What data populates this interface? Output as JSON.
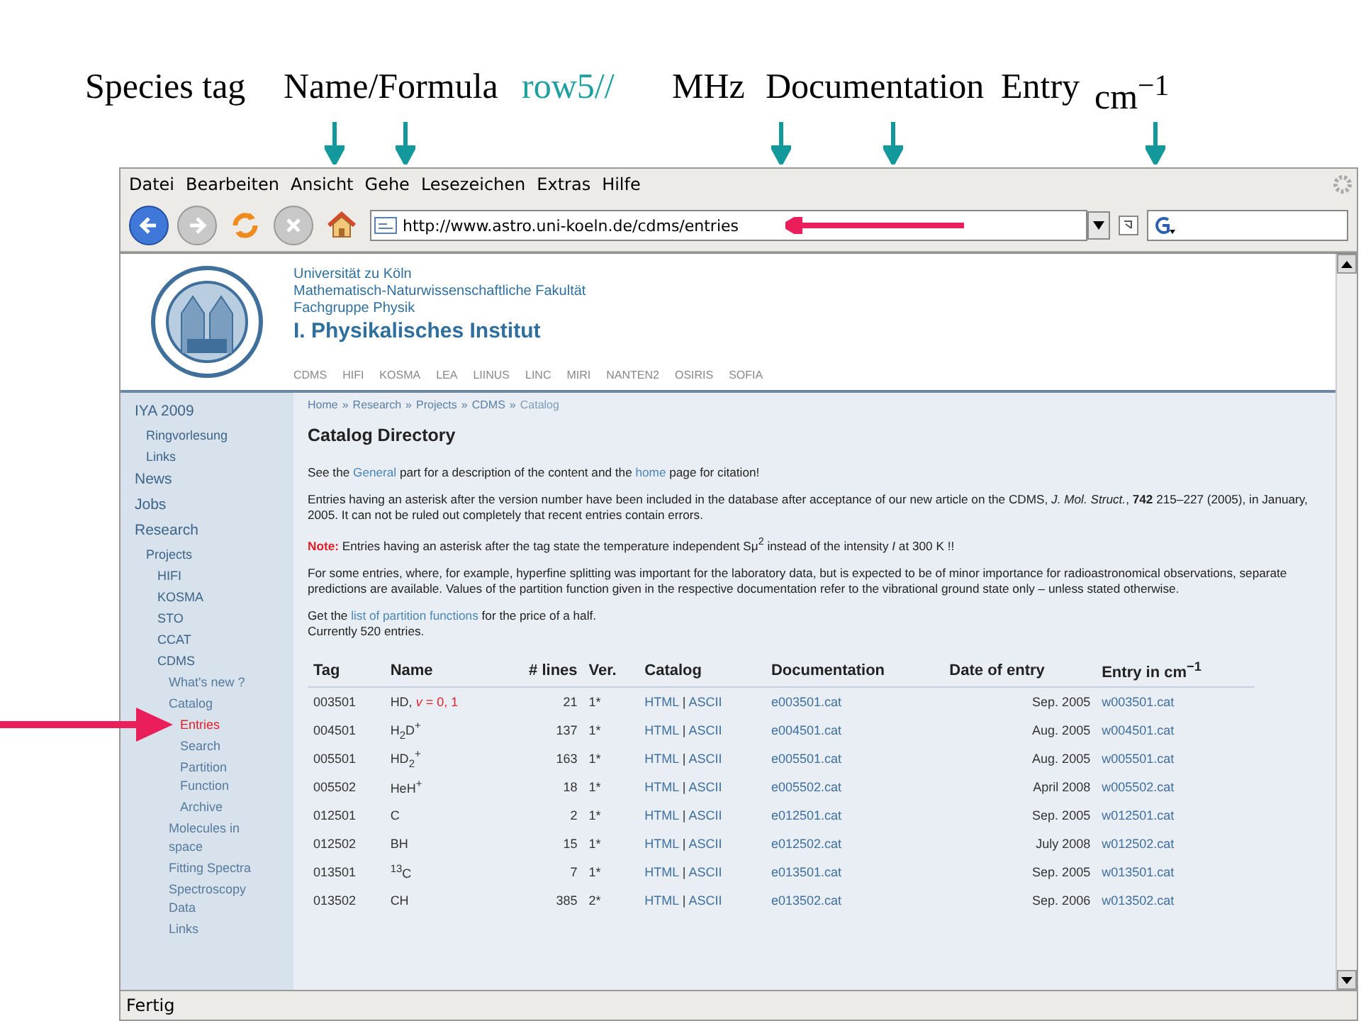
{
  "annotations": [
    {
      "text": "Species tag",
      "kind": "plain"
    },
    {
      "text": "Name/Formula",
      "kind": "plain"
    },
    {
      "text": "row5//",
      "kind": "accent"
    },
    {
      "text": "MHz",
      "kind": "plain"
    },
    {
      "text": "Documentation",
      "kind": "plain"
    },
    {
      "text": "Entry",
      "kind": "plain"
    },
    {
      "text": "cm$^{−1}$",
      "kind": "plain"
    }
  ],
  "menu": [
    "Datei",
    "Bearbeiten",
    "Ansicht",
    "Gehe",
    "Lesezeichen",
    "Extras",
    "Hilfe"
  ],
  "address": {
    "value": "http://www.astro.uni-koeln.de/cdms/entries"
  },
  "header": {
    "lines": [
      "Universität zu Köln",
      "Mathematisch-Naturwissenschaftliche Fakultät",
      "Fachgruppe Physik"
    ],
    "title": "I. Physikalisches Institut",
    "nav": [
      "CDMS",
      "HIFI",
      "KOSMA",
      "LEA",
      "LIINUS",
      "LINC",
      "MIRI",
      "NANTEN2",
      "OSIRIS",
      "SOFIA"
    ]
  },
  "sidebar": [
    {
      "label": "IYA 2009",
      "selected": false,
      "children": [
        {
          "label": "Ringvorlesung",
          "selected": false
        },
        {
          "label": "Links",
          "selected": false
        }
      ]
    },
    {
      "label": "News",
      "selected": false
    },
    {
      "label": "Jobs",
      "selected": false
    },
    {
      "label": "Research",
      "selected": false,
      "children": [
        {
          "label": "Projects",
          "selected": false,
          "children": [
            {
              "label": "HIFI",
              "selected": false
            },
            {
              "label": "KOSMA",
              "selected": false
            },
            {
              "label": "STO",
              "selected": false
            },
            {
              "label": "CCAT",
              "selected": false
            },
            {
              "label": "CDMS",
              "selected": false,
              "children": [
                {
                  "label": "What's new ?",
                  "selected": false
                },
                {
                  "label": "Catalog",
                  "selected": false,
                  "children": [
                    {
                      "label": "Entries",
                      "selected": true
                    },
                    {
                      "label": "Search",
                      "selected": false
                    },
                    {
                      "label": "Partition Function",
                      "selected": false
                    },
                    {
                      "label": "Archive",
                      "selected": false
                    }
                  ]
                },
                {
                  "label": "Molecules in space",
                  "selected": false
                },
                {
                  "label": "Fitting Spectra",
                  "selected": false
                },
                {
                  "label": "Spectroscopy Data",
                  "selected": false
                },
                {
                  "label": "Links",
                  "selected": false
                }
              ]
            }
          ]
        }
      ]
    }
  ],
  "breadcrumb": {
    "separator": "»",
    "items": [
      "Home",
      "Research",
      "Projects",
      "CDMS",
      "Catalog"
    ]
  },
  "page_title": "Catalog Directory",
  "paragraphs": [
    {
      "kind": "text",
      "parts": [
        {
          "kind": "text",
          "text": "See the "
        },
        {
          "kind": "link",
          "text": "General"
        },
        {
          "kind": "text",
          "text": " part for a description of the content and the "
        },
        {
          "kind": "link",
          "text": "home"
        },
        {
          "kind": "text",
          "text": " page for citation!"
        }
      ]
    },
    {
      "kind": "text",
      "parts": [
        {
          "kind": "text",
          "text": "Entries having an asterisk after the version number have been included in the database after acceptance of our new article on the CDMS, *J. Mol. Struct.*, **742** 215–227 (2005), in January, 2005. It can not be ruled out completely that recent entries contain errors."
        }
      ]
    },
    {
      "kind": "note",
      "label": "Note:",
      "parts": [
        {
          "kind": "text",
          "text": "Entries having an asterisk after the tag state the temperature independent Sμ$^{2}$ instead of the intensity *I* at 300 K !!"
        }
      ]
    },
    {
      "kind": "text",
      "parts": [
        {
          "kind": "text",
          "text": "For some entries, where, for example, hyperfine splitting was important for the laboratory data, but is expected to be of minor importance for radioastronomical observations, separate predictions are available. Values of the partition function given in the respective documentation refer to the vibrational ground state only – unless stated otherwise."
        }
      ]
    },
    {
      "kind": "text",
      "parts": [
        {
          "kind": "text",
          "text": "Get the "
        },
        {
          "kind": "link",
          "text": "list of partition functions"
        },
        {
          "kind": "text",
          "text": " for the price of a half."
        },
        {
          "kind": "break",
          "text": "Currently 520 entries."
        }
      ]
    }
  ],
  "table": {
    "columns": [
      "Tag",
      "Name",
      "# lines",
      "Ver.",
      "Catalog",
      "Documentation",
      "Date of entry",
      "Entry in cm$^{−1}$"
    ],
    "rows": [
      {
        "tag": "003501",
        "name": "HD,",
        "note": "*v* = 0, 1",
        "lines": "21",
        "ver": "1*",
        "html": "HTML",
        "sep": "|",
        "ascii": "ASCII",
        "doc": "e003501.cat",
        "date": "Sep. 2005",
        "entry": "w003501.cat"
      },
      {
        "tag": "004501",
        "name": "H$_{2}$D$^{+}$",
        "lines": "137",
        "ver": "1*",
        "html": "HTML",
        "sep": "|",
        "ascii": "ASCII",
        "doc": "e004501.cat",
        "date": "Aug. 2005",
        "entry": "w004501.cat"
      },
      {
        "tag": "005501",
        "name": "HD$_{2}$$^{+}$",
        "lines": "163",
        "ver": "1*",
        "html": "HTML",
        "sep": "|",
        "ascii": "ASCII",
        "doc": "e005501.cat",
        "date": "Aug. 2005",
        "entry": "w005501.cat"
      },
      {
        "tag": "005502",
        "name": "HeH$^{+}$",
        "lines": "18",
        "ver": "1*",
        "html": "HTML",
        "sep": "|",
        "ascii": "ASCII",
        "doc": "e005502.cat",
        "date": "April 2008",
        "entry": "w005502.cat"
      },
      {
        "tag": "012501",
        "name": "C",
        "lines": "2",
        "ver": "1*",
        "html": "HTML",
        "sep": "|",
        "ascii": "ASCII",
        "doc": "e012501.cat",
        "date": "Sep. 2005",
        "entry": "w012501.cat"
      },
      {
        "tag": "012502",
        "name": "BH",
        "lines": "15",
        "ver": "1*",
        "html": "HTML",
        "sep": "|",
        "ascii": "ASCII",
        "doc": "e012502.cat",
        "date": "July 2008",
        "entry": "w012502.cat"
      },
      {
        "tag": "013501",
        "name": "$^{13}$C",
        "lines": "7",
        "ver": "1*",
        "html": "HTML",
        "sep": "|",
        "ascii": "ASCII",
        "doc": "e013501.cat",
        "date": "Sep. 2005",
        "entry": "w013501.cat"
      },
      {
        "tag": "013502",
        "name": "CH",
        "lines": "385",
        "ver": "2*",
        "html": "HTML",
        "sep": "|",
        "ascii": "ASCII",
        "doc": "e013502.cat",
        "date": "Sep. 2006",
        "entry": "w013502.cat"
      }
    ]
  },
  "status_bar": "Fertig"
}
